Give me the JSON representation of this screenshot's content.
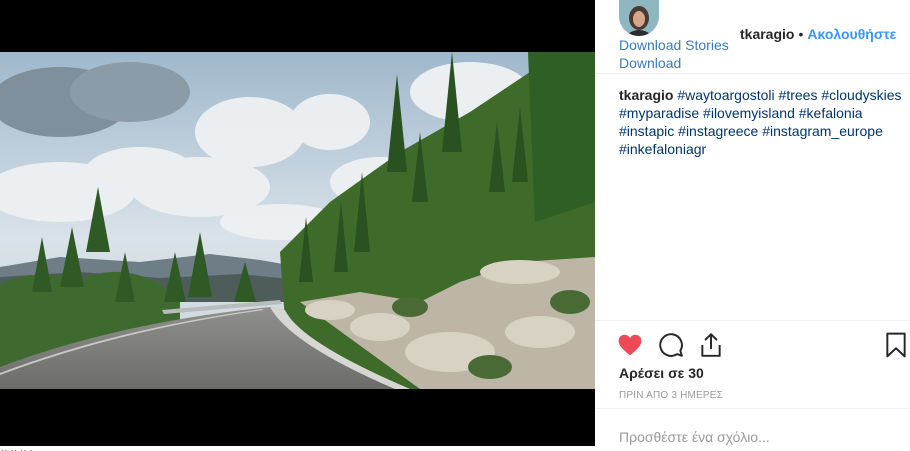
{
  "post": {
    "media_alt": "Winding mountain road with cypress trees under cloudy skies",
    "header": {
      "download_stories_label": "Download Stories",
      "download_label": "Download",
      "username": "tkaragio",
      "separator": "•",
      "follow_label": "Ακολουθήστε"
    },
    "caption": {
      "username": "tkaragio",
      "hashtags": [
        "#waytoargostoli",
        "#trees",
        "#cloudyskies",
        "#myparadise",
        "#ilovemyisland",
        "#kefalonia",
        "#instapic",
        "#instagreece",
        "#instagram_europe",
        "#inkefaloniagr"
      ]
    },
    "actions": {
      "like_icon": "heart-icon",
      "comment_icon": "comment-icon",
      "share_icon": "share-icon",
      "save_icon": "bookmark-icon",
      "like_color": "#ed4956"
    },
    "likes_text": "Αρέσει σε 30",
    "time_ago": "ΠΡΙΝ ΑΠΟ 3 ΗΜΕΡΕΣ",
    "comment_placeholder": "Προσθέστε ένα σχόλιο...",
    "stray_text": "·· ·· ·· ·"
  },
  "colors": {
    "link": "#3d7ab4",
    "follow": "#3897f0",
    "hashtag": "#003569",
    "muted": "#999999",
    "divider": "#efefef"
  }
}
